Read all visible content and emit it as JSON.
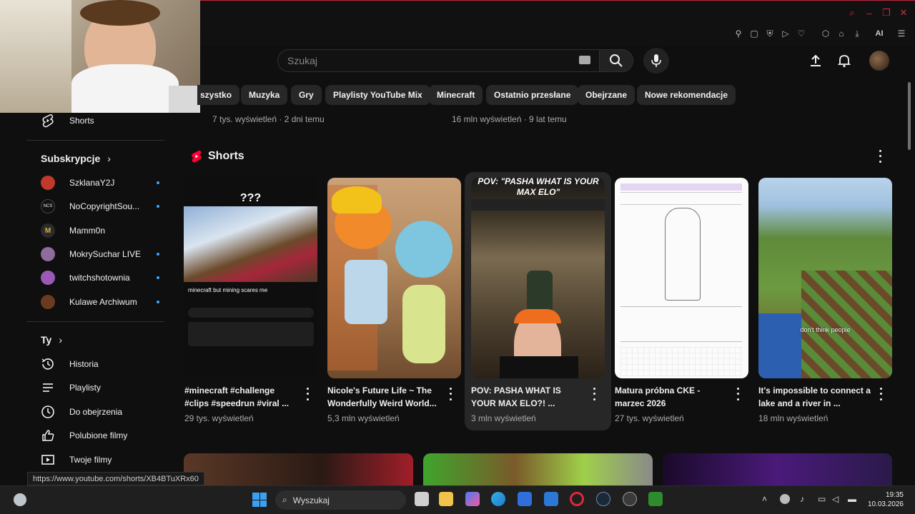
{
  "search": {
    "placeholder": "Szukaj"
  },
  "chips": [
    {
      "label": "szystko"
    },
    {
      "label": "Muzyka"
    },
    {
      "label": "Gry"
    },
    {
      "label": "Playlisty YouTube Mix"
    },
    {
      "label": "Minecraft"
    },
    {
      "label": "Ostatnio przesłane"
    },
    {
      "label": "Obejrzane"
    },
    {
      "label": "Nowe rekomendacje"
    }
  ],
  "prev_row": [
    {
      "meta": "7 tys. wyświetleń · 2 dni temu"
    },
    {
      "meta": "16 mln wyświetleń · 9 lat temu"
    }
  ],
  "sidebar": {
    "shorts_label": "Shorts",
    "subscriptions_title": "Subskrypcje",
    "subscriptions": [
      {
        "name": "SzklanaY2J",
        "color": "#c0392b"
      },
      {
        "name": "NoCopyrightSou...",
        "color": "#111111"
      },
      {
        "name": "Mamm0n",
        "color": "#2b2b2b"
      },
      {
        "name": "MokrySuchar LIVE",
        "color": "#8e6d9c"
      },
      {
        "name": "twitchshotownia",
        "color": "#9b59b6"
      },
      {
        "name": "Kulawe Archiwum",
        "color": "#6b3a1f"
      }
    ],
    "you_title": "Ty",
    "you_items": [
      {
        "label": "Historia"
      },
      {
        "label": "Playlisty"
      },
      {
        "label": "Do obejrzenia"
      },
      {
        "label": "Polubione filmy"
      },
      {
        "label": "Twoje filmy"
      }
    ]
  },
  "shorts": {
    "title": "Shorts",
    "items": [
      {
        "title": "#minecraft #challenge #clips #speedrun #viral ...",
        "views": "29 tys. wyświetleń",
        "thumb_text": "???",
        "thumb_caption": "minecraft but mining scares me"
      },
      {
        "title": "Nicole's Future Life ~ The Wonderfully Weird World...",
        "views": "5,3 mln wyświetleń"
      },
      {
        "title": "POV: PASHA WHAT IS YOUR MAX ELO?! ...",
        "views": "3 mln wyświetleń",
        "thumb_text": "POV: \"PASHA WHAT IS YOUR MAX ELO\""
      },
      {
        "title": "Matura próbna CKE - marzec 2026",
        "views": "27 tys. wyświetleń"
      },
      {
        "title": "It's impossible to connect a lake and a river in ...",
        "views": "18 mln wyświetleń",
        "thumb_text": "don't think people"
      }
    ]
  },
  "status_url": "https://www.youtube.com/shorts/XB4BTuXRx60",
  "taskbar": {
    "search_label": "Wyszukaj",
    "time": "19:35",
    "date": "10.03.2026"
  },
  "toolbar": {
    "ai_label": "AI"
  }
}
